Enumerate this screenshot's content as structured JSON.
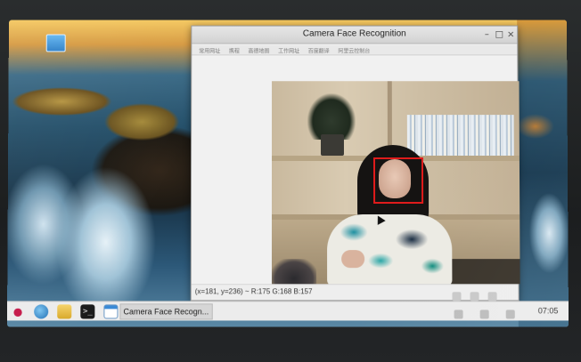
{
  "window": {
    "title": "Camera Face Recognition",
    "buttons": {
      "minimize": "–",
      "maximize": "□",
      "close": "×"
    }
  },
  "bookmarks": [
    "常用网址",
    "携程",
    "高德地图",
    "工作网址",
    "百度翻译",
    "阿里云控制台"
  ],
  "status": {
    "text": "(x=181, y=236) ~ R:175 G:168 B:157"
  },
  "taskbar": {
    "menu_icon": "raspberry-menu-icon",
    "terminal_glyph": ">_",
    "task_label": "Camera Face Recogn...",
    "clock": "07:05"
  },
  "colors": {
    "face_box": "#e01b1b",
    "taskbar_bg": "#ececec",
    "window_title_bg": "#d9d9d9"
  }
}
